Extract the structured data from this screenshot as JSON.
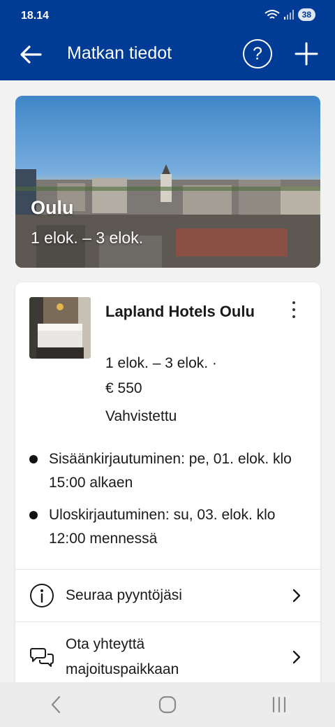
{
  "status_bar": {
    "time": "18.14",
    "battery": "38"
  },
  "header": {
    "title": "Matkan tiedot"
  },
  "hero": {
    "city": "Oulu",
    "dates": "1 elok. – 3 elok."
  },
  "booking": {
    "hotel_name": "Lapland Hotels Oulu",
    "dates": "1 elok. – 3 elok. ·",
    "price": "€ 550",
    "status": "Vahvistettu",
    "check_in": "Sisäänkirjautuminen: pe, 01. elok. klo 15:00 alkaen",
    "check_out": "Uloskirjautuminen: su, 03. elok. klo 12:00 mennessä"
  },
  "actions": [
    {
      "label": "Seuraa pyyntöjäsi",
      "icon": "info-icon"
    },
    {
      "label": "Ota yhteyttä majoituspaikkaan",
      "icon": "chat-icon"
    }
  ],
  "colors": {
    "brand_blue": "#003b95"
  }
}
